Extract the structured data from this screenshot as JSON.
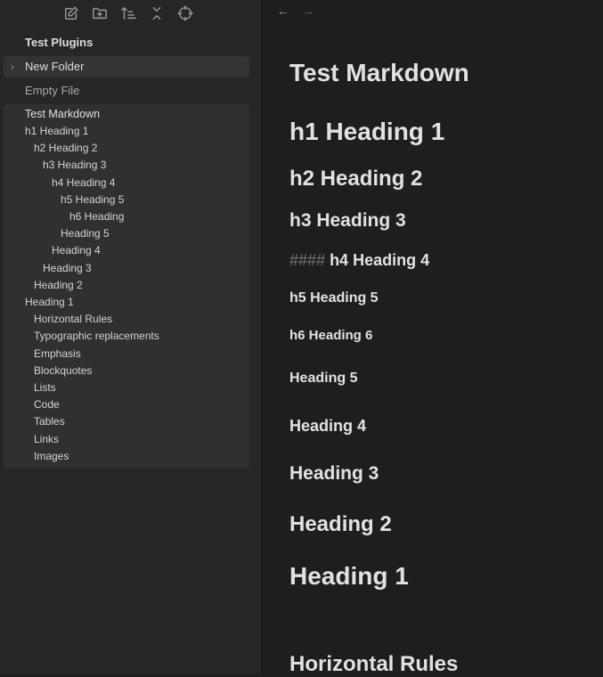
{
  "sidebar": {
    "toolbar_icons": [
      "new-note-icon",
      "new-folder-icon",
      "sort-icon",
      "collapse-all-icon",
      "reveal-file-icon"
    ],
    "vault_name": "Test Plugins",
    "folder": {
      "label": "New Folder",
      "icon": "chevron-right-icon"
    },
    "file": {
      "label": "Empty File"
    },
    "outline": {
      "title": "Test Markdown",
      "items": [
        {
          "label": "h1 Heading 1",
          "level": 1
        },
        {
          "label": "h2 Heading 2",
          "level": 2
        },
        {
          "label": "h3 Heading 3",
          "level": 3
        },
        {
          "label": "h4 Heading 4",
          "level": 4
        },
        {
          "label": "h5 Heading 5",
          "level": 5
        },
        {
          "label": "h6 Heading",
          "level": 6
        },
        {
          "label": "Heading 5",
          "level": 5
        },
        {
          "label": "Heading 4",
          "level": 4
        },
        {
          "label": "Heading 3",
          "level": 3
        },
        {
          "label": "Heading 2",
          "level": 2
        },
        {
          "label": "Heading 1",
          "level": 1
        },
        {
          "label": "Horizontal Rules",
          "level": 2
        },
        {
          "label": "Typographic replacements",
          "level": 2
        },
        {
          "label": "Emphasis",
          "level": 2
        },
        {
          "label": "Blockquotes",
          "level": 2
        },
        {
          "label": "Lists",
          "level": 2
        },
        {
          "label": "Code",
          "level": 2
        },
        {
          "label": "Tables",
          "level": 2
        },
        {
          "label": "Links",
          "level": 2
        },
        {
          "label": "Images",
          "level": 2
        }
      ]
    }
  },
  "editor": {
    "nav": {
      "back": "←",
      "forward": "→"
    },
    "title": "Test Markdown",
    "h1_heading": "h1 Heading 1",
    "h2_heading": "h2 Heading 2",
    "h3_heading": "h3 Heading 3",
    "h4_marker": "####",
    "h4_heading": "h4 Heading 4",
    "h5_heading": "h5 Heading 5",
    "h6_heading": "h6 Heading 6",
    "heading5": "Heading 5",
    "heading4": "Heading 4",
    "heading3": "Heading 3",
    "heading2": "Heading 2",
    "heading1": "Heading 1",
    "horizontal_rules": "Horizontal Rules"
  }
}
